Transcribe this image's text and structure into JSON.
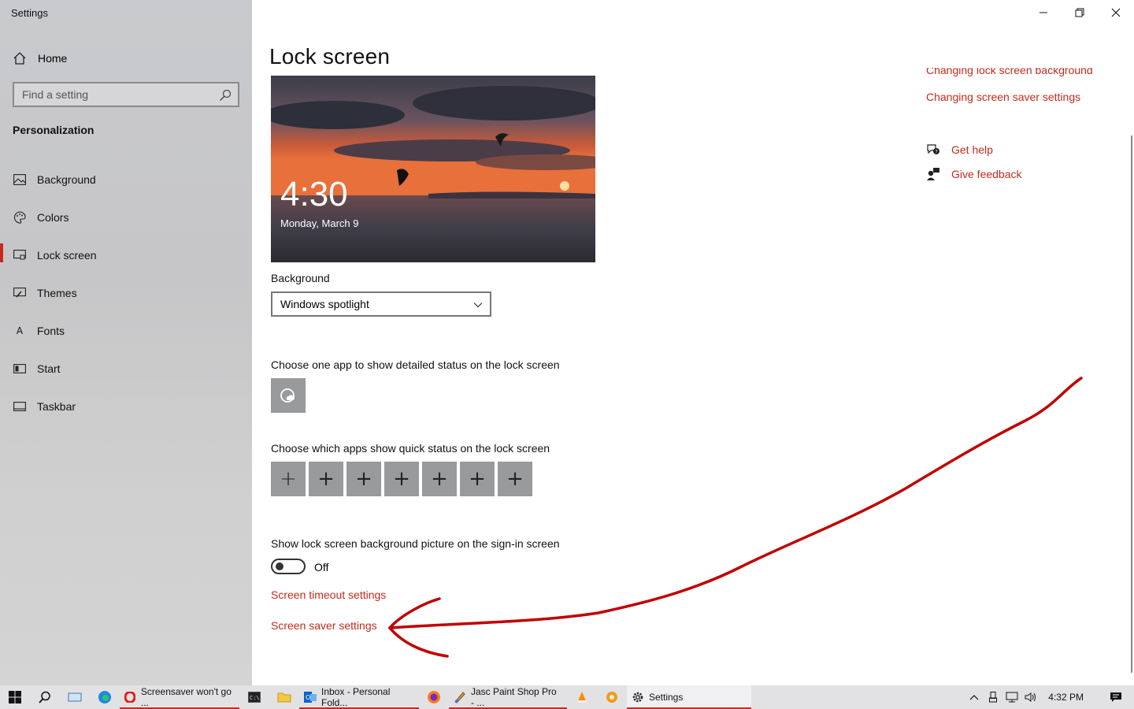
{
  "window": {
    "title": "Settings"
  },
  "sidebar": {
    "home_label": "Home",
    "search_placeholder": "Find a setting",
    "section_title": "Personalization",
    "items": [
      {
        "label": "Background",
        "icon": "picture-icon"
      },
      {
        "label": "Colors",
        "icon": "palette-icon"
      },
      {
        "label": "Lock screen",
        "icon": "lock-screen-icon",
        "active": true
      },
      {
        "label": "Themes",
        "icon": "brush-icon"
      },
      {
        "label": "Fonts",
        "icon": "font-icon"
      },
      {
        "label": "Start",
        "icon": "start-icon"
      },
      {
        "label": "Taskbar",
        "icon": "taskbar-icon"
      }
    ]
  },
  "main": {
    "title": "Lock screen",
    "preview": {
      "time": "4:30",
      "date": "Monday, March 9"
    },
    "background_label": "Background",
    "background_value": "Windows spotlight",
    "detailed_status_label": "Choose one app to show detailed status on the lock screen",
    "quick_status_label": "Choose which apps show quick status on the lock screen",
    "quick_status_slots": [
      "+",
      "+",
      "+",
      "+",
      "+",
      "+",
      "+"
    ],
    "signin_label": "Show lock screen background picture on the sign-in screen",
    "signin_toggle_state": "Off",
    "timeout_link": "Screen timeout settings",
    "screensaver_link": "Screen saver settings"
  },
  "aside": {
    "related_links": [
      "Changing lock screen background",
      "Changing screen saver settings"
    ],
    "help_label": "Get help",
    "feedback_label": "Give feedback"
  },
  "taskbar": {
    "apps": [
      {
        "label": "Screensaver won't go ...",
        "icon": "opera-icon",
        "running": true
      },
      {
        "label": "Inbox - Personal Fold...",
        "icon": "outlook-icon",
        "running": true
      },
      {
        "label": "Jasc Paint Shop Pro - ...",
        "icon": "paint-shop-icon",
        "running": true
      },
      {
        "label": "Settings",
        "icon": "gear-icon",
        "running": true
      }
    ],
    "clock": "4:32 PM"
  },
  "colors": {
    "accent": "#c42b1c",
    "annotation": "#c00000"
  }
}
